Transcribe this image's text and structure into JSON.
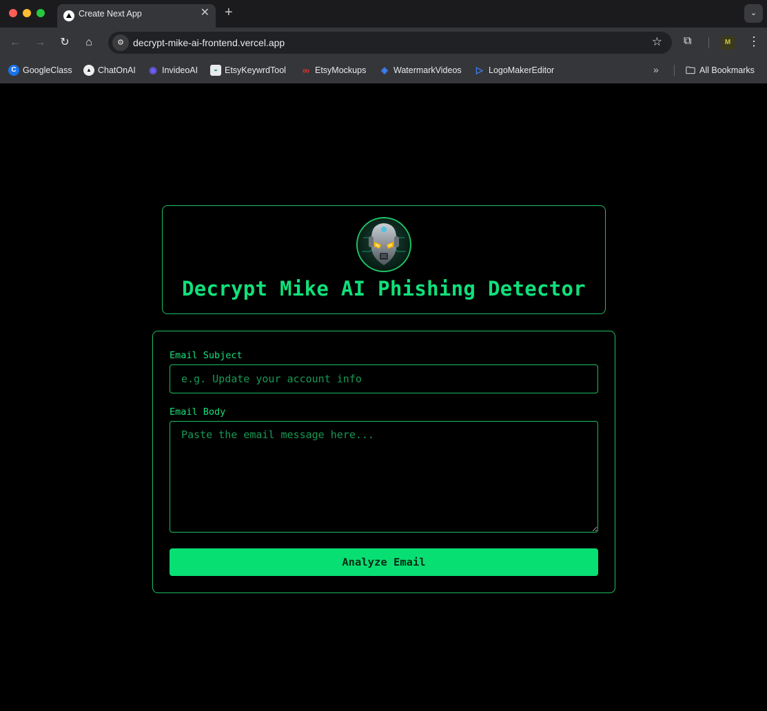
{
  "browser": {
    "tab_title": "Create Next App",
    "url": "decrypt-mike-ai-frontend.vercel.app",
    "bookmarks": [
      {
        "label": "GoogleClass",
        "icon": "c-logo-icon",
        "glyph": "C",
        "color": "#1a73e8"
      },
      {
        "label": "ChatOnAI",
        "icon": "triangle-logo-icon",
        "glyph": "▲",
        "color": "#111111"
      },
      {
        "label": "InvideoAI",
        "icon": "invideo-logo-icon",
        "glyph": "◉",
        "color": "#6d5dfc"
      },
      {
        "label": "EtsyKeywrdTool",
        "icon": "etsy-tool-logo-icon",
        "glyph": "◒",
        "color": "#e8eaed"
      },
      {
        "label": "EtsyMockups",
        "icon": "meta-logo-icon",
        "glyph": "∞",
        "color": "#e5322d"
      },
      {
        "label": "WatermarkVideos",
        "icon": "watermark-logo-icon",
        "glyph": "◈",
        "color": "#3b82f6"
      },
      {
        "label": "LogoMakerEditor",
        "icon": "play-logo-icon",
        "glyph": "▷",
        "color": "#3b82f6"
      }
    ],
    "all_bookmarks_label": "All Bookmarks",
    "profile_glyph": "M"
  },
  "app": {
    "title": "Decrypt Mike AI Phishing Detector",
    "subject_label": "Email Subject",
    "subject_placeholder": "e.g. Update your account info",
    "body_label": "Email Body",
    "body_placeholder": "Paste the email message here...",
    "analyze_label": "Analyze Email"
  },
  "theme": {
    "accent": "#08df73",
    "border": "#1fc064",
    "background": "#000000"
  }
}
